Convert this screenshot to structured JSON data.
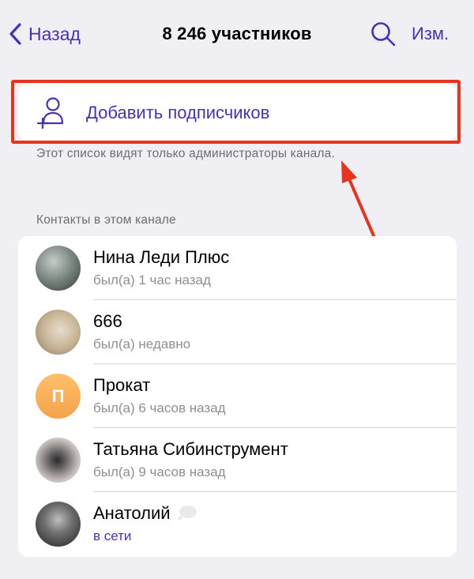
{
  "nav": {
    "back_label": "Назад",
    "title": "8 246 участников",
    "edit_label": "Изм."
  },
  "add_subscribers": {
    "label": "Добавить подписчиков",
    "hint": "Этот список видят только администраторы канала."
  },
  "contacts": {
    "header": "Контакты в этом канале",
    "items": [
      {
        "name": "Нина Леди Плюс",
        "status": "был(а) 1 час назад",
        "avatar": "photo"
      },
      {
        "name": "666",
        "status": "был(а) недавно",
        "avatar": "photo"
      },
      {
        "name": "Прокат",
        "status": "был(а) 6 часов назад",
        "avatar": "letter",
        "initial": "П"
      },
      {
        "name": "Татьяна Сибинструмент",
        "status": "был(а) 9 часов назад",
        "avatar": "photo"
      },
      {
        "name": "Анатолий",
        "status": "в сети",
        "avatar": "photo"
      }
    ]
  },
  "colors": {
    "accent": "#4a2fbd",
    "highlight": "#e8341c",
    "background": "#efeff4",
    "secondary_text": "#8e8e93"
  },
  "icons": [
    "chevron-left-icon",
    "search-icon",
    "add-person-icon",
    "arrow-annotation"
  ]
}
